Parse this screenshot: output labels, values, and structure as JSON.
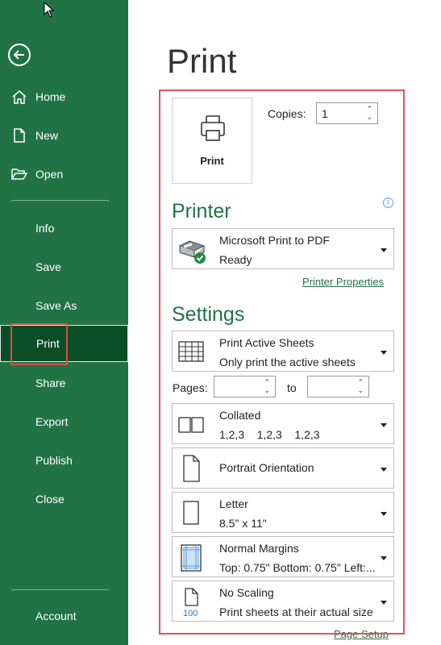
{
  "sidebar": {
    "items": [
      {
        "label": "Home",
        "icon": "home-icon"
      },
      {
        "label": "New",
        "icon": "new-document-icon"
      },
      {
        "label": "Open",
        "icon": "open-folder-icon"
      },
      {
        "label": "Info"
      },
      {
        "label": "Save"
      },
      {
        "label": "Save As"
      },
      {
        "label": "Print"
      },
      {
        "label": "Share"
      },
      {
        "label": "Export"
      },
      {
        "label": "Publish"
      },
      {
        "label": "Close"
      },
      {
        "label": "Account"
      }
    ]
  },
  "page_title": "Print",
  "print_button_label": "Print",
  "copies": {
    "label": "Copies:",
    "value": "1"
  },
  "printer": {
    "heading": "Printer",
    "name": "Microsoft Print to PDF",
    "status": "Ready",
    "properties_link": "Printer Properties"
  },
  "settings": {
    "heading": "Settings",
    "what_to_print": {
      "title": "Print Active Sheets",
      "subtitle": "Only print the active sheets"
    },
    "pages_label": "Pages:",
    "to_label": "to",
    "collation": {
      "title": "Collated",
      "subtitle": "1,2,3    1,2,3    1,2,3"
    },
    "orientation": {
      "title": "Portrait Orientation"
    },
    "paper": {
      "title": "Letter",
      "subtitle": "8.5\" x 11\""
    },
    "margins": {
      "title": "Normal Margins",
      "subtitle": "Top: 0.75\" Bottom: 0.75\" Left:..."
    },
    "scaling": {
      "title": "No Scaling",
      "subtitle": "Print sheets at their actual size",
      "icon_text": "100"
    },
    "page_setup_link": "Page Setup"
  },
  "colors": {
    "accent": "#217346",
    "highlight": "#e04a4a"
  }
}
